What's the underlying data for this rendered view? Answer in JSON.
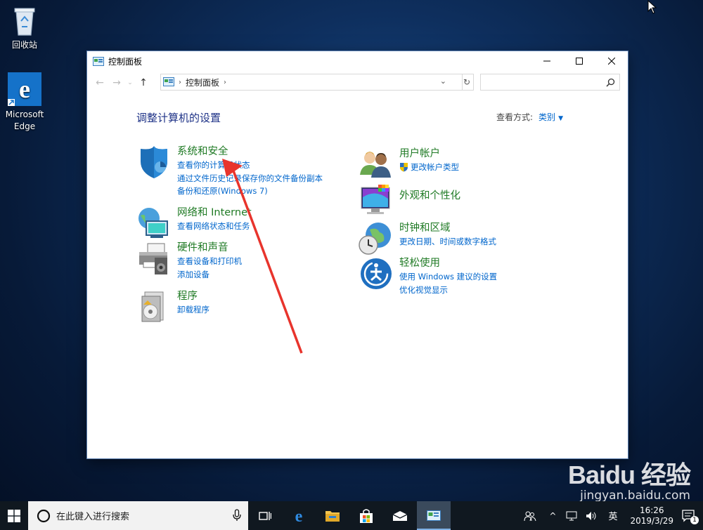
{
  "desktop": {
    "recycle_bin_label": "回收站",
    "edge_label_1": "Microsoft",
    "edge_label_2": "Edge"
  },
  "window": {
    "title": "控制面板",
    "address": {
      "root_sep": "›",
      "crumb": "控制面板",
      "trail_sep": "›"
    },
    "search_placeholder": "",
    "heading": "调整计算机的设置",
    "view_by": {
      "label": "查看方式:",
      "value": "类别"
    }
  },
  "categories": {
    "system_security": {
      "title": "系统和安全",
      "links": [
        "查看你的计算机状态",
        "通过文件历史记录保存你的文件备份副本",
        "备份和还原(Windows 7)"
      ]
    },
    "network": {
      "title": "网络和 Internet",
      "links": [
        "查看网络状态和任务"
      ]
    },
    "hardware": {
      "title": "硬件和声音",
      "links": [
        "查看设备和打印机",
        "添加设备"
      ]
    },
    "programs": {
      "title": "程序",
      "links": [
        "卸载程序"
      ]
    },
    "user_accounts": {
      "title": "用户帐户",
      "links": [
        "更改帐户类型"
      ]
    },
    "appearance": {
      "title": "外观和个性化",
      "links": []
    },
    "clock_region": {
      "title": "时钟和区域",
      "links": [
        "更改日期、时间或数字格式"
      ]
    },
    "ease_access": {
      "title": "轻松使用",
      "links": [
        "使用 Windows 建议的设置",
        "优化视觉显示"
      ]
    }
  },
  "taskbar": {
    "search_text": "在此键入进行搜索",
    "ime": "英",
    "time": "16:26",
    "date": "2019/3/29",
    "notification_count": "1"
  },
  "watermark": {
    "brand": "Baidu 经验",
    "url": "jingyan.baidu.com"
  },
  "colors": {
    "category_title": "#1f7a24",
    "link": "#0066cc",
    "heading": "#1e3287",
    "annotation_arrow": "#e8342c"
  }
}
